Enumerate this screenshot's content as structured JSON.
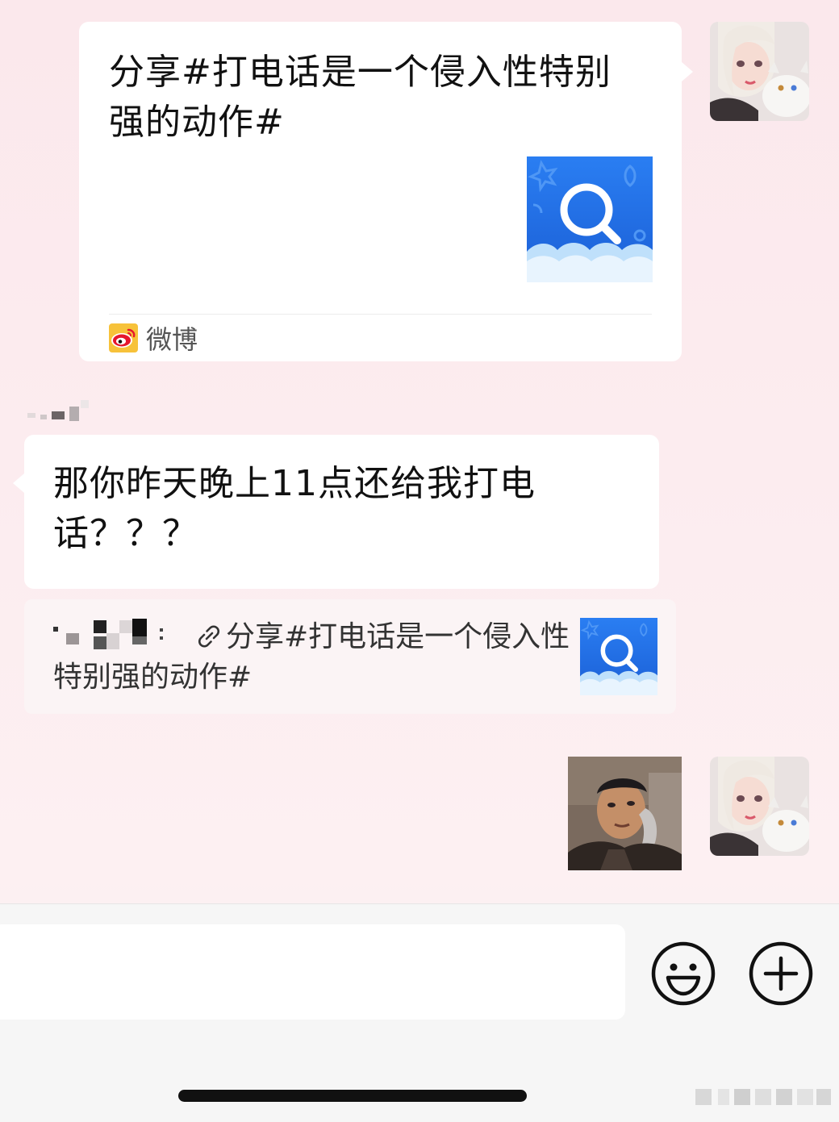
{
  "chat": {
    "card": {
      "title": "分享#打电话是一个侵入性特别强的动作#",
      "source_label": "微博",
      "source_icon": "weibo-icon",
      "thumbnail_icon": "search-icon",
      "thumbnail_color": "#1a6fe8"
    },
    "incoming": {
      "text": "那你昨天晚上11点还给我打电话？？？"
    },
    "quote": {
      "text": "分享#打电话是一个侵入性特别强的动作#",
      "link_icon": "link-icon",
      "thumbnail_icon": "search-icon"
    },
    "sticker": {
      "icon": "sticker-image"
    }
  },
  "input_bar": {
    "value": "",
    "emoji_icon": "smiley-icon",
    "plus_icon": "plus-icon"
  },
  "colors": {
    "background": "#fbe8ec",
    "bubble": "#ffffff",
    "accent_blue": "#1a6fe8"
  }
}
